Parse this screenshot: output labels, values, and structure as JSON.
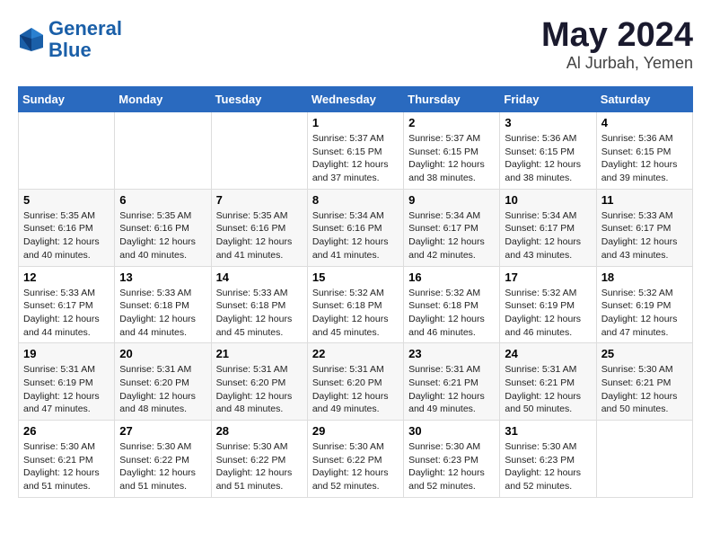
{
  "header": {
    "logo_line1": "General",
    "logo_line2": "Blue",
    "month": "May 2024",
    "location": "Al Jurbah, Yemen"
  },
  "days_of_week": [
    "Sunday",
    "Monday",
    "Tuesday",
    "Wednesday",
    "Thursday",
    "Friday",
    "Saturday"
  ],
  "weeks": [
    [
      {
        "day": "",
        "sunrise": "",
        "sunset": "",
        "daylight": ""
      },
      {
        "day": "",
        "sunrise": "",
        "sunset": "",
        "daylight": ""
      },
      {
        "day": "",
        "sunrise": "",
        "sunset": "",
        "daylight": ""
      },
      {
        "day": "1",
        "sunrise": "Sunrise: 5:37 AM",
        "sunset": "Sunset: 6:15 PM",
        "daylight": "Daylight: 12 hours and 37 minutes."
      },
      {
        "day": "2",
        "sunrise": "Sunrise: 5:37 AM",
        "sunset": "Sunset: 6:15 PM",
        "daylight": "Daylight: 12 hours and 38 minutes."
      },
      {
        "day": "3",
        "sunrise": "Sunrise: 5:36 AM",
        "sunset": "Sunset: 6:15 PM",
        "daylight": "Daylight: 12 hours and 38 minutes."
      },
      {
        "day": "4",
        "sunrise": "Sunrise: 5:36 AM",
        "sunset": "Sunset: 6:15 PM",
        "daylight": "Daylight: 12 hours and 39 minutes."
      }
    ],
    [
      {
        "day": "5",
        "sunrise": "Sunrise: 5:35 AM",
        "sunset": "Sunset: 6:16 PM",
        "daylight": "Daylight: 12 hours and 40 minutes."
      },
      {
        "day": "6",
        "sunrise": "Sunrise: 5:35 AM",
        "sunset": "Sunset: 6:16 PM",
        "daylight": "Daylight: 12 hours and 40 minutes."
      },
      {
        "day": "7",
        "sunrise": "Sunrise: 5:35 AM",
        "sunset": "Sunset: 6:16 PM",
        "daylight": "Daylight: 12 hours and 41 minutes."
      },
      {
        "day": "8",
        "sunrise": "Sunrise: 5:34 AM",
        "sunset": "Sunset: 6:16 PM",
        "daylight": "Daylight: 12 hours and 41 minutes."
      },
      {
        "day": "9",
        "sunrise": "Sunrise: 5:34 AM",
        "sunset": "Sunset: 6:17 PM",
        "daylight": "Daylight: 12 hours and 42 minutes."
      },
      {
        "day": "10",
        "sunrise": "Sunrise: 5:34 AM",
        "sunset": "Sunset: 6:17 PM",
        "daylight": "Daylight: 12 hours and 43 minutes."
      },
      {
        "day": "11",
        "sunrise": "Sunrise: 5:33 AM",
        "sunset": "Sunset: 6:17 PM",
        "daylight": "Daylight: 12 hours and 43 minutes."
      }
    ],
    [
      {
        "day": "12",
        "sunrise": "Sunrise: 5:33 AM",
        "sunset": "Sunset: 6:17 PM",
        "daylight": "Daylight: 12 hours and 44 minutes."
      },
      {
        "day": "13",
        "sunrise": "Sunrise: 5:33 AM",
        "sunset": "Sunset: 6:18 PM",
        "daylight": "Daylight: 12 hours and 44 minutes."
      },
      {
        "day": "14",
        "sunrise": "Sunrise: 5:33 AM",
        "sunset": "Sunset: 6:18 PM",
        "daylight": "Daylight: 12 hours and 45 minutes."
      },
      {
        "day": "15",
        "sunrise": "Sunrise: 5:32 AM",
        "sunset": "Sunset: 6:18 PM",
        "daylight": "Daylight: 12 hours and 45 minutes."
      },
      {
        "day": "16",
        "sunrise": "Sunrise: 5:32 AM",
        "sunset": "Sunset: 6:18 PM",
        "daylight": "Daylight: 12 hours and 46 minutes."
      },
      {
        "day": "17",
        "sunrise": "Sunrise: 5:32 AM",
        "sunset": "Sunset: 6:19 PM",
        "daylight": "Daylight: 12 hours and 46 minutes."
      },
      {
        "day": "18",
        "sunrise": "Sunrise: 5:32 AM",
        "sunset": "Sunset: 6:19 PM",
        "daylight": "Daylight: 12 hours and 47 minutes."
      }
    ],
    [
      {
        "day": "19",
        "sunrise": "Sunrise: 5:31 AM",
        "sunset": "Sunset: 6:19 PM",
        "daylight": "Daylight: 12 hours and 47 minutes."
      },
      {
        "day": "20",
        "sunrise": "Sunrise: 5:31 AM",
        "sunset": "Sunset: 6:20 PM",
        "daylight": "Daylight: 12 hours and 48 minutes."
      },
      {
        "day": "21",
        "sunrise": "Sunrise: 5:31 AM",
        "sunset": "Sunset: 6:20 PM",
        "daylight": "Daylight: 12 hours and 48 minutes."
      },
      {
        "day": "22",
        "sunrise": "Sunrise: 5:31 AM",
        "sunset": "Sunset: 6:20 PM",
        "daylight": "Daylight: 12 hours and 49 minutes."
      },
      {
        "day": "23",
        "sunrise": "Sunrise: 5:31 AM",
        "sunset": "Sunset: 6:21 PM",
        "daylight": "Daylight: 12 hours and 49 minutes."
      },
      {
        "day": "24",
        "sunrise": "Sunrise: 5:31 AM",
        "sunset": "Sunset: 6:21 PM",
        "daylight": "Daylight: 12 hours and 50 minutes."
      },
      {
        "day": "25",
        "sunrise": "Sunrise: 5:30 AM",
        "sunset": "Sunset: 6:21 PM",
        "daylight": "Daylight: 12 hours and 50 minutes."
      }
    ],
    [
      {
        "day": "26",
        "sunrise": "Sunrise: 5:30 AM",
        "sunset": "Sunset: 6:21 PM",
        "daylight": "Daylight: 12 hours and 51 minutes."
      },
      {
        "day": "27",
        "sunrise": "Sunrise: 5:30 AM",
        "sunset": "Sunset: 6:22 PM",
        "daylight": "Daylight: 12 hours and 51 minutes."
      },
      {
        "day": "28",
        "sunrise": "Sunrise: 5:30 AM",
        "sunset": "Sunset: 6:22 PM",
        "daylight": "Daylight: 12 hours and 51 minutes."
      },
      {
        "day": "29",
        "sunrise": "Sunrise: 5:30 AM",
        "sunset": "Sunset: 6:22 PM",
        "daylight": "Daylight: 12 hours and 52 minutes."
      },
      {
        "day": "30",
        "sunrise": "Sunrise: 5:30 AM",
        "sunset": "Sunset: 6:23 PM",
        "daylight": "Daylight: 12 hours and 52 minutes."
      },
      {
        "day": "31",
        "sunrise": "Sunrise: 5:30 AM",
        "sunset": "Sunset: 6:23 PM",
        "daylight": "Daylight: 12 hours and 52 minutes."
      },
      {
        "day": "",
        "sunrise": "",
        "sunset": "",
        "daylight": ""
      }
    ]
  ]
}
